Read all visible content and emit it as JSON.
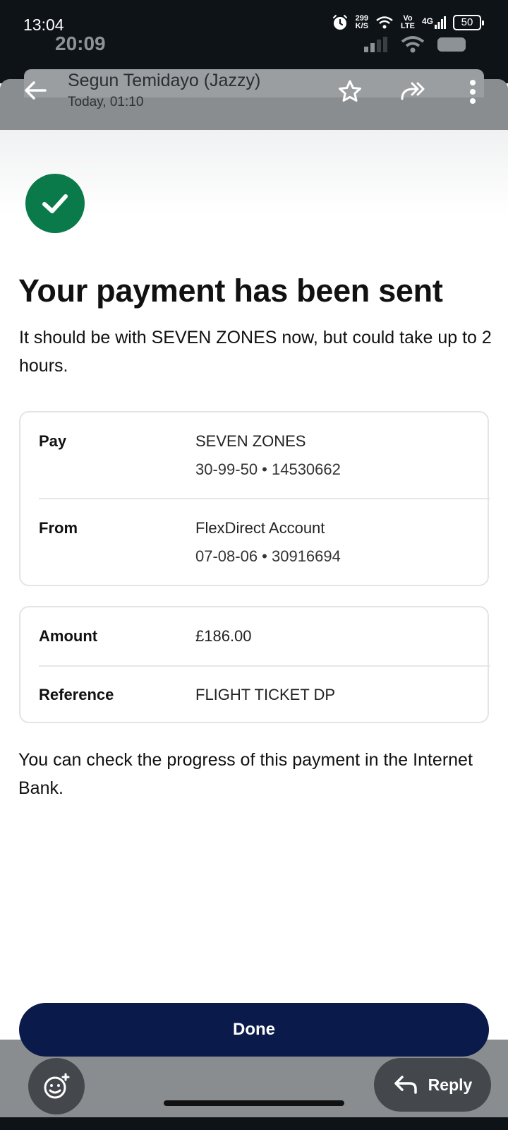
{
  "status_bar": {
    "time": "13:04",
    "secondary_time": "20:09",
    "net_speed_value": "299",
    "net_speed_unit": "K/S",
    "volte_top": "Vo",
    "volte_bottom": "LTE",
    "network": "4G",
    "battery": "50"
  },
  "email": {
    "sender": "Segun Temidayo (Jazzy)",
    "date": "Today, 01:10"
  },
  "payment": {
    "title": "Your payment has been sent",
    "subtitle": "It should be with SEVEN ZONES now, but could take up to 2 hours.",
    "pay_label": "Pay",
    "pay_name": "SEVEN ZONES",
    "pay_account": "30-99-50 • 14530662",
    "from_label": "From",
    "from_name": "FlexDirect Account",
    "from_account": "07-08-06 • 30916694",
    "amount_label": "Amount",
    "amount_value": "£186.00",
    "reference_label": "Reference",
    "reference_value": "FLIGHT TICKET DP",
    "note": "You can check the progress of this payment in the Internet Bank.",
    "done_label": "Done"
  },
  "actions": {
    "reply_label": "Reply"
  },
  "colors": {
    "success_green": "#0a7a4a",
    "done_navy": "#0a1a4a",
    "status_bar": "#0e1317"
  },
  "icons": [
    "back-arrow-icon",
    "star-icon",
    "forward-all-icon",
    "more-vertical-icon",
    "checkmark-icon",
    "add-emoji-icon",
    "reply-icon",
    "alarm-icon",
    "wifi-icon",
    "signal-icon",
    "battery-icon"
  ]
}
